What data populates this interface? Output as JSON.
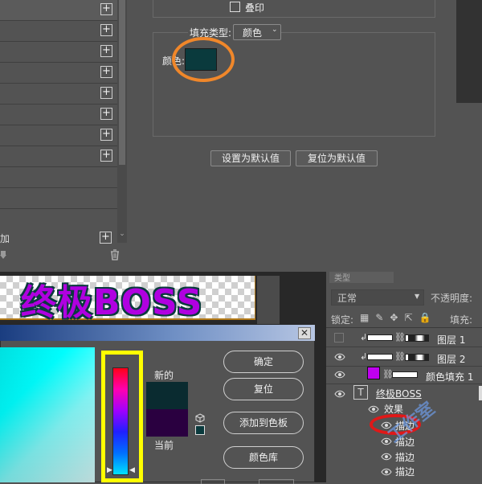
{
  "layer_style_list": {
    "fx_label": "加",
    "row_count": 10
  },
  "blending_options": {
    "overprint_label": "叠印",
    "fill_type_label": "填充类型:",
    "fill_type_value": "颜色",
    "color_label": "颜色:",
    "color_value": "#0a3a3d",
    "set_default_button": "设置为默认值",
    "reset_default_button": "复位为默认值"
  },
  "canvas": {
    "text": "终极BOSS"
  },
  "color_picker": {
    "new_label": "新的",
    "current_label": "当前",
    "ok_button": "确定",
    "reset_button": "复位",
    "add_to_swatches_button": "添加到色板",
    "color_library_button": "颜色库",
    "close_glyph": "✕",
    "new_color": "#0a2b30",
    "current_color": "#2a0040"
  },
  "layers_panel": {
    "tab_label": "类型",
    "blend_mode": "正常",
    "opacity_label": "不透明度:",
    "lock_label": "锁定:",
    "lock_icons": "▦✎✥⇱🔒",
    "fill_label": "填充:",
    "layers": [
      {
        "name": "图层 1",
        "visible": false
      },
      {
        "name": "图层 2",
        "visible": true
      },
      {
        "name": "颜色填充 1",
        "visible": true
      },
      {
        "name": "终极BOSS",
        "visible": true
      }
    ],
    "effects_label": "效果",
    "effects": [
      "描边",
      "描边",
      "描边",
      "描边"
    ],
    "watermark": "工作室"
  },
  "colors": {
    "highlight_orange": "#f0872a",
    "highlight_yellow": "#ffff00",
    "highlight_red": "#e01818"
  }
}
